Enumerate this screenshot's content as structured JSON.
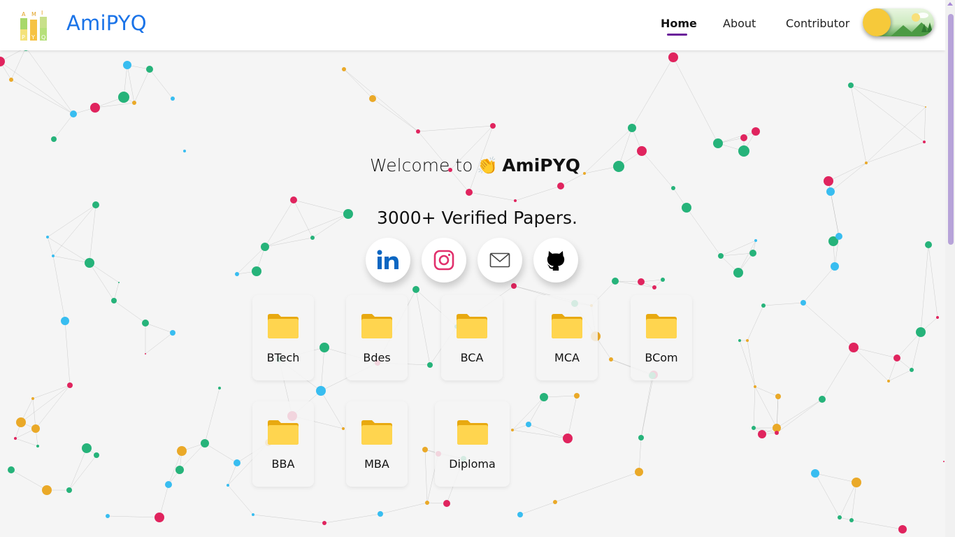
{
  "header": {
    "logo_letters": [
      "A",
      "M",
      "I",
      "P",
      "Y",
      "Q"
    ],
    "brand": "AmiPYQ",
    "nav": [
      {
        "label": "Home",
        "active": true
      },
      {
        "label": "About",
        "active": false
      },
      {
        "label": "Contributor",
        "active": false
      }
    ],
    "theme_toggle": {
      "state": "light",
      "icon": "sun-icon"
    }
  },
  "hero": {
    "welcome_prefix": "Welcome to",
    "wave_emoji": "👏",
    "welcome_name": "AmiPYQ",
    "tagline": "3000+ Verified Papers."
  },
  "social": [
    {
      "name": "linkedin",
      "icon": "linkedin-icon",
      "color": "#0a66c2"
    },
    {
      "name": "instagram",
      "icon": "instagram-icon",
      "color": "#e1306c"
    },
    {
      "name": "email",
      "icon": "mail-icon",
      "color": "#444444"
    },
    {
      "name": "github",
      "icon": "github-icon",
      "color": "#000000"
    }
  ],
  "courses": [
    {
      "label": "BTech"
    },
    {
      "label": "Bdes"
    },
    {
      "label": "BCA"
    },
    {
      "label": "MCA"
    },
    {
      "label": "BCom"
    },
    {
      "label": "BBA"
    },
    {
      "label": "MBA"
    },
    {
      "label": "Diploma"
    }
  ],
  "colors": {
    "brand": "#1a73e8",
    "nav_underline": "#6a1b9a",
    "folder": "#ffd54f",
    "dot_palette": [
      "#e0245e",
      "#26b37a",
      "#38bdf0",
      "#eaa928"
    ]
  }
}
